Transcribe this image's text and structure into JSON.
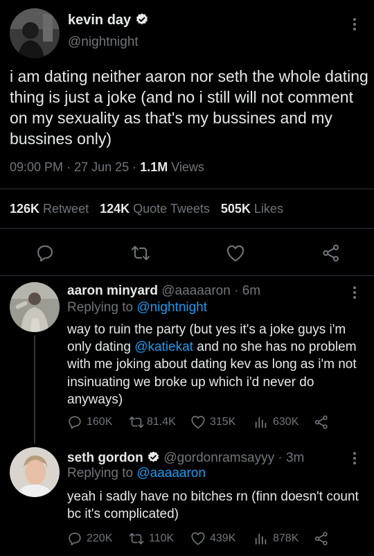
{
  "main_tweet": {
    "display_name": "kevin day",
    "handle": "@nightnight",
    "text": "i am dating neither aaron nor seth the whole dating thing is just a joke (and no i still will not comment on my sexuality as that's my bussines and my bussines only)",
    "time": "09:00 PM",
    "date": "27 Jun 25",
    "views_count": "1.1M",
    "views_label": "Views",
    "sep": "·",
    "stats": {
      "retweets_count": "126K",
      "retweets_label": "Retweet",
      "quotes_count": "124K",
      "quotes_label": "Quote Tweets",
      "likes_count": "505K",
      "likes_label": "Likes"
    }
  },
  "replies": [
    {
      "display_name": "aaron minyard",
      "handle": "@aaaaaron",
      "sep": "·",
      "time": "6m",
      "replying_prefix": "Replying to",
      "replying_to": "@nightnight",
      "text_1": "way to ruin the party (but yes it's a joke guys i'm only dating ",
      "mention": "@katiekat",
      "text_2": " and no she has no problem with me joking about dating kev as long as i'm not insinuating we broke up which i'd never do anyways)",
      "replies_count": "160K",
      "retweets_count": "81.4K",
      "likes_count": "315K",
      "views_count": "630K"
    },
    {
      "display_name": "seth gordon",
      "handle": "@gordonramsayyy",
      "sep": "·",
      "time": "3m",
      "replying_prefix": "Replying to",
      "replying_to": "@aaaaaron",
      "text": "yeah i sadly have no bitches rn (finn doesn't count bc it's complicated)",
      "replies_count": "220K",
      "retweets_count": "110K",
      "likes_count": "439K",
      "views_count": "878K"
    }
  ],
  "colors": {
    "background": "#000000",
    "text": "#e7e9ea",
    "muted": "#71767b",
    "link": "#1d9bf0",
    "divider": "#2f3336"
  }
}
